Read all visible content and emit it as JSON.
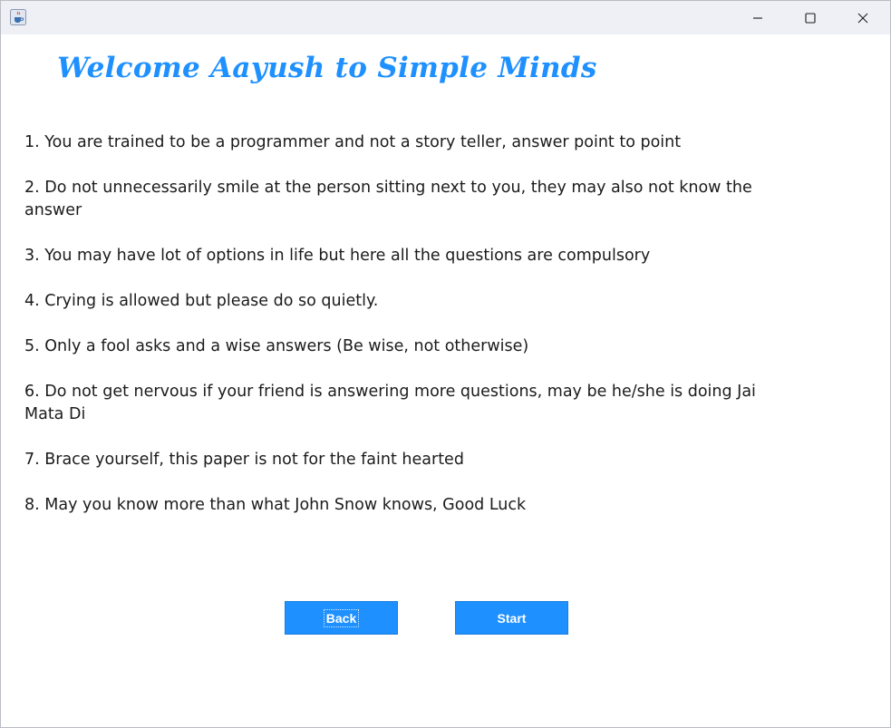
{
  "window": {
    "icon": "java-cup-icon",
    "controls": [
      "minimize-icon",
      "maximize-icon",
      "close-icon"
    ]
  },
  "heading": "Welcome Aayush to Simple Minds",
  "rules": [
    "1. You are trained to be a programmer and not a story teller, answer point to point",
    "2. Do not unnecessarily smile at the person sitting next to you, they may also not know the answer",
    "3. You may have lot of options in life but here all the questions are compulsory",
    "4. Crying is allowed but please do so quietly.",
    "5. Only a fool asks and a wise answers (Be wise, not otherwise)",
    "6. Do not get nervous if your friend is answering more questions, may be he/she is doing Jai Mata Di",
    "7. Brace yourself, this paper is not for the faint hearted",
    "8. May you know more than what John Snow knows, Good Luck"
  ],
  "buttons": {
    "back": "Back",
    "start": "Start"
  },
  "colors": {
    "accent": "#1e90ff",
    "text": "#1b1b1b",
    "titlebar": "#eef0f6"
  }
}
